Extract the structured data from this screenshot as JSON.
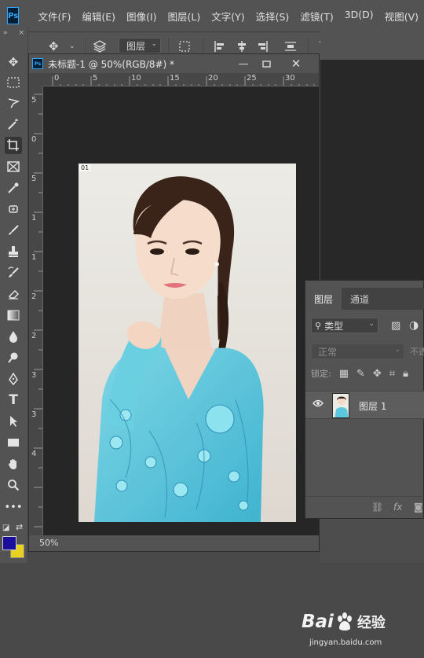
{
  "app": {
    "logo_text": "Ps",
    "menu": [
      "文件(F)",
      "编辑(E)",
      "图像(I)",
      "图层(L)",
      "文字(Y)",
      "选择(S)",
      "滤镜(T)",
      "3D(D)",
      "视图(V)"
    ]
  },
  "options_bar": {
    "layer_select": "图层",
    "icons": [
      "move-icon",
      "auto-select-icon",
      "align-icons"
    ]
  },
  "toolbar": {
    "collapse_label": "»",
    "close_label": "×",
    "tools": [
      "move-tool",
      "marquee-tool",
      "lasso-tool",
      "magic-wand-tool",
      "crop-tool",
      "frame-tool",
      "eyedropper-tool",
      "healing-brush-tool",
      "brush-tool",
      "clone-stamp-tool",
      "history-brush-tool",
      "eraser-tool",
      "gradient-tool",
      "blur-tool",
      "dodge-tool",
      "pen-tool",
      "type-tool",
      "path-selection-tool",
      "rectangle-tool",
      "hand-tool",
      "zoom-tool",
      "more-tools"
    ],
    "type_tool_label": "T",
    "foreground_color": "#1a0e9a",
    "background_color": "#e8d21e"
  },
  "document": {
    "ps_badge": "Ps",
    "title": "未标题-1 @ 50%(RGB/8#) *",
    "ruler_top": [
      "0",
      "5",
      "10",
      "15",
      "20",
      "25",
      "30"
    ],
    "ruler_left": [
      "5",
      "0",
      "5",
      "1",
      "1",
      "2",
      "2",
      "3",
      "3",
      "4"
    ],
    "photo_badge": "01",
    "zoom": "50%"
  },
  "layers_panel": {
    "tabs": [
      "图层",
      "通道"
    ],
    "filter_label": "类型",
    "blend_mode": "正常",
    "opacity_label": "不透",
    "lock_label": "锁定:",
    "layer_name": "图层 1",
    "layer_visible": true
  },
  "watermark": {
    "brand_left": "Bai",
    "brand_right": "经验",
    "url": "jingyan.baidu.com"
  }
}
